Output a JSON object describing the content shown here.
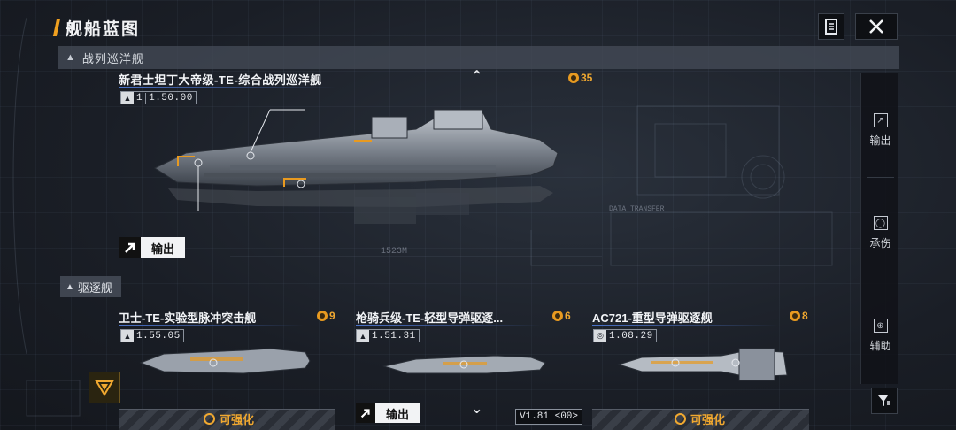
{
  "header": {
    "title": "舰船蓝图",
    "doc_icon": "document-icon",
    "close_icon": "close-icon"
  },
  "category_bar": {
    "label": "战列巡洋舰",
    "icon": "ship-category-icon"
  },
  "featured": {
    "name": "新君士坦丁大帝级-TE-综合战列巡洋舰",
    "tier": "1",
    "value": "1.50.00",
    "cost": "35",
    "role_label": "输出",
    "blueprint_texts": {
      "data_transfer": "DATA TRANSFER",
      "length": "1523M"
    }
  },
  "side_panel": {
    "items": [
      {
        "label": "输出",
        "icon": "output-arrow-icon"
      },
      {
        "label": "承伤",
        "icon": "shield-icon"
      },
      {
        "label": "辅助",
        "icon": "support-icon"
      }
    ],
    "filter_icon": "filter-icon"
  },
  "destroyer_section": {
    "label": "驱逐舰",
    "icon": "ship-category-icon"
  },
  "cards": [
    {
      "name": "卫士-TE-实验型脉冲突击舰",
      "value": "1.55.05",
      "cost": "9",
      "footer": "可强化"
    },
    {
      "name": "枪骑兵级-TE-轻型导弹驱逐...",
      "value": "1.51.31",
      "cost": "6",
      "role_label": "输出",
      "version": "V1.81 <00>"
    },
    {
      "name": "AC721-重型导弹驱逐舰",
      "value": "1.08.29",
      "cost": "8",
      "footer": "可强化"
    }
  ],
  "colors": {
    "accent": "#f0a830",
    "name_underline": "#4a72c8",
    "panel_bg": "#1a1e26"
  }
}
